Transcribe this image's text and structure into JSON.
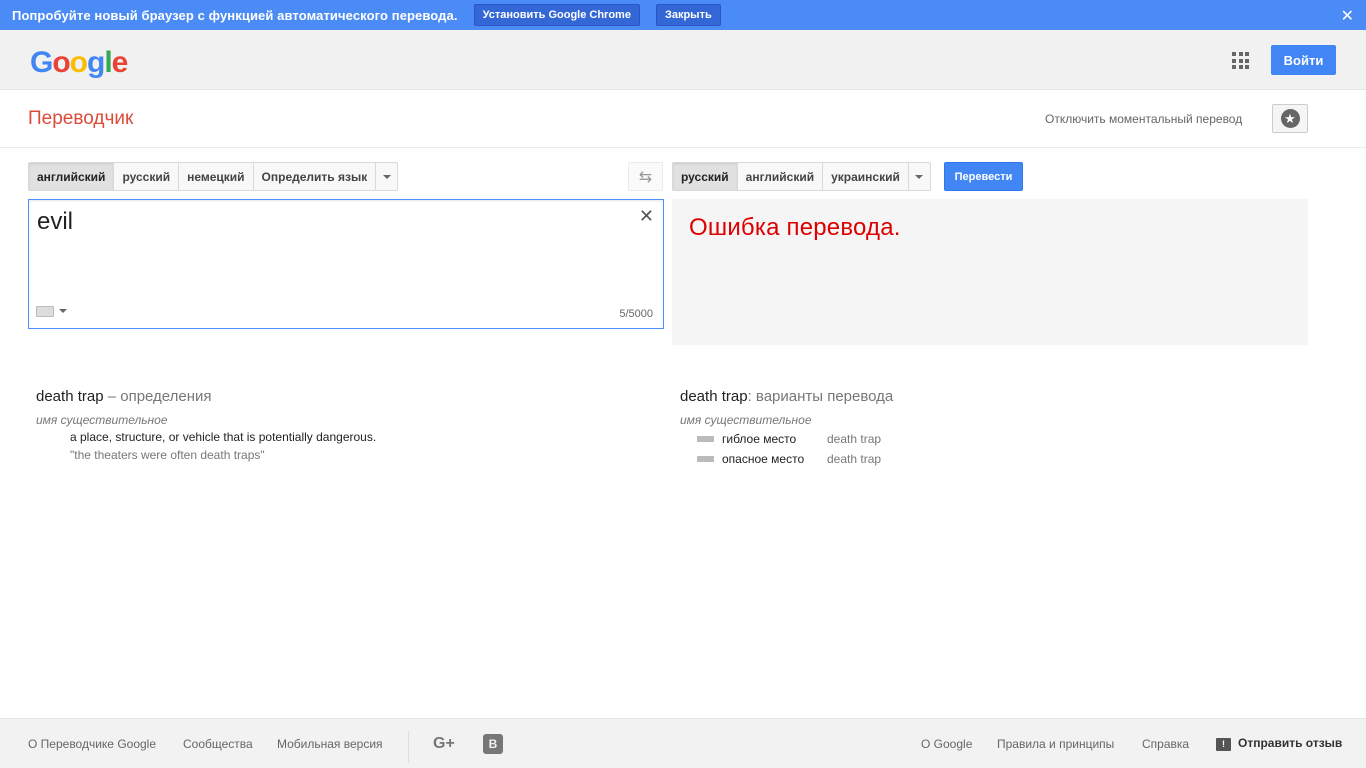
{
  "promo": {
    "text": "Попробуйте новый браузер с функцией автоматического перевода.",
    "install_label": "Установить Google Chrome",
    "close_label": "Закрыть",
    "dismiss_glyph": "✕"
  },
  "header": {
    "logo": [
      "G",
      "o",
      "o",
      "g",
      "l",
      "e"
    ],
    "signin_label": "Войти"
  },
  "subheader": {
    "title": "Переводчик",
    "instant_toggle": "Отключить моментальный перевод"
  },
  "source_langs": {
    "tabs": [
      "английский",
      "русский",
      "немецкий",
      "Определить язык"
    ],
    "selected": "английский"
  },
  "target_langs": {
    "tabs": [
      "русский",
      "английский",
      "украинский"
    ],
    "selected": "русский"
  },
  "translate_button": "Перевести",
  "source": {
    "text": "evil",
    "char_count": "5/5000"
  },
  "result": {
    "error": "Ошибка перевода."
  },
  "definitions": {
    "term": "death trap",
    "suffix": " – определения",
    "part_of_speech": "имя существительное",
    "definition": "a place, structure, or vehicle that is potentially dangerous.",
    "example": "\"the theaters were often death traps\""
  },
  "variants": {
    "term": "death trap",
    "suffix": ": варианты перевода",
    "part_of_speech": "имя существительное",
    "rows": [
      {
        "word": "гиблое место",
        "back": "death trap"
      },
      {
        "word": "опасное место",
        "back": "death trap"
      }
    ]
  },
  "footer": {
    "left_links": [
      "О Переводчике Google",
      "Сообщества",
      "Мобильная версия"
    ],
    "right_links": [
      "О Google",
      "Правила и принципы",
      "Справка"
    ],
    "gplus": "G+",
    "blogger": "B",
    "feedback": "Отправить отзыв"
  },
  "colors": {
    "accent": "#4285f4",
    "title_red": "#dd4b39",
    "error_red": "#dd0000",
    "promo_bg": "#4b8bf5"
  }
}
